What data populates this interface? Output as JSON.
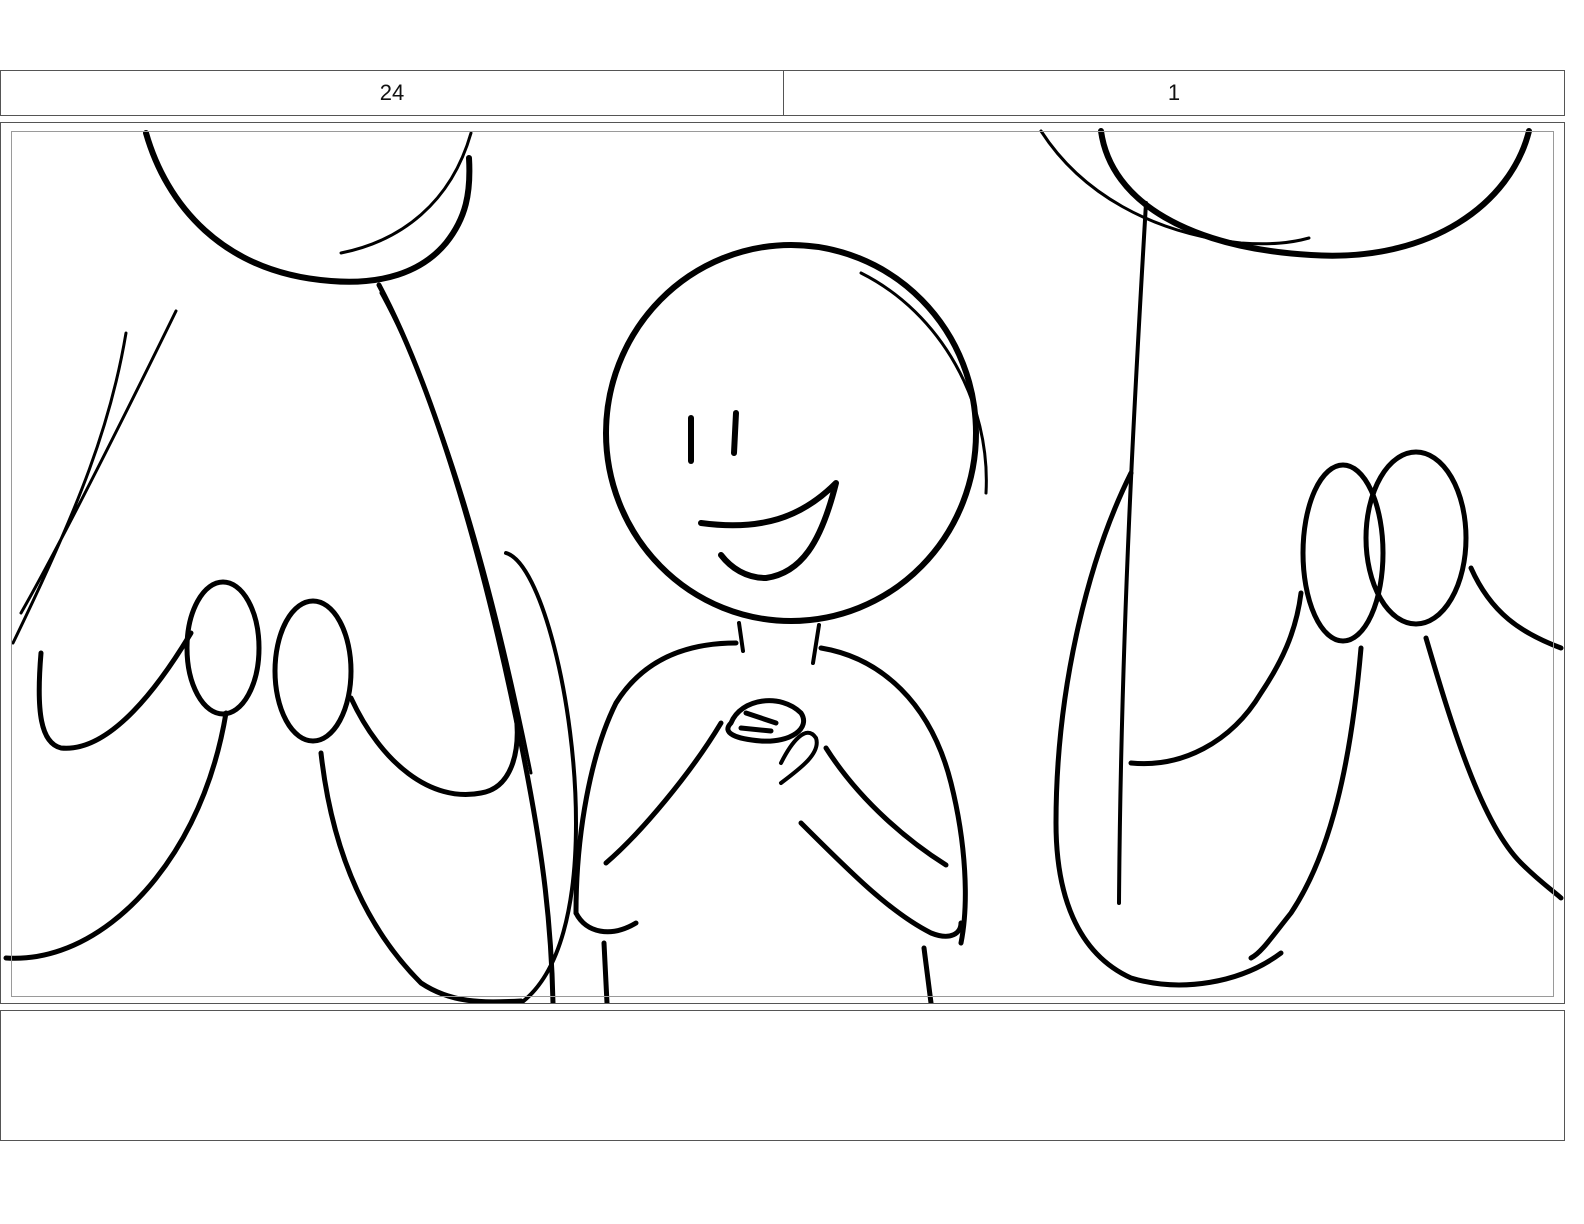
{
  "header": {
    "scene_number": "24",
    "panel_number": "1"
  },
  "panel": {
    "image_icon": "storyboard-sketch",
    "stroke_color": "#000000",
    "background_color": "#ffffff"
  },
  "notes": {
    "text": ""
  }
}
